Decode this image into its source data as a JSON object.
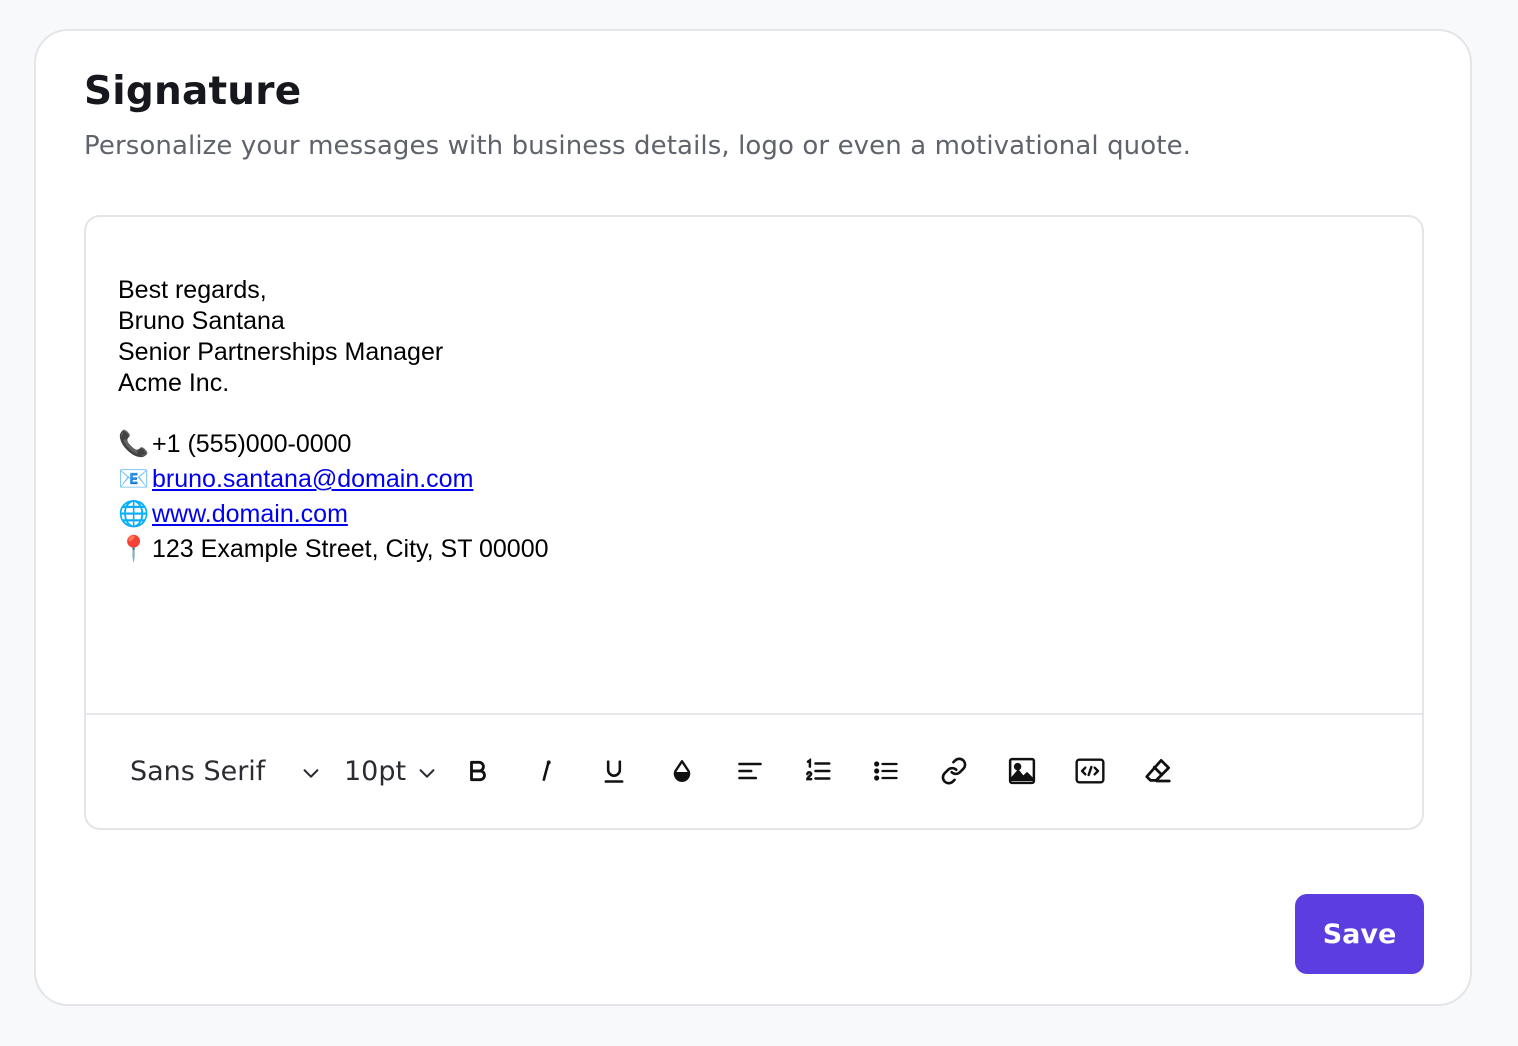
{
  "header": {
    "title": "Signature",
    "subtitle": "Personalize your messages with business details, logo or even a motivational quote."
  },
  "editor": {
    "lines": [
      "Best regards,",
      "Bruno Santana",
      "Senior Partnerships Manager",
      "Acme Inc."
    ],
    "contacts": {
      "phone": {
        "icon": "phone-icon",
        "glyph": "📞",
        "text": "+1 (555)000-0000"
      },
      "email": {
        "icon": "envelope-icon",
        "glyph": "📧",
        "text": "bruno.santana@domain.com"
      },
      "web": {
        "icon": "globe-icon",
        "glyph": "🌐",
        "text": "www.domain.com"
      },
      "address": {
        "icon": "pin-icon",
        "glyph": "📍",
        "text": "123 Example Street, City, ST 00000"
      }
    },
    "link_color": "#0000ee"
  },
  "toolbar": {
    "font_family": "Sans Serif",
    "font_size": "10pt",
    "buttons": [
      "bold-icon",
      "italic-icon",
      "underline-icon",
      "text-color-icon",
      "align-left-icon",
      "ordered-list-icon",
      "bullet-list-icon",
      "link-icon",
      "image-icon",
      "code-icon",
      "clear-format-icon"
    ]
  },
  "actions": {
    "save_label": "Save"
  },
  "colors": {
    "accent": "#5b3de0",
    "title": "#16181d",
    "subtitle": "#5f636b",
    "border": "#e3e5e9"
  }
}
